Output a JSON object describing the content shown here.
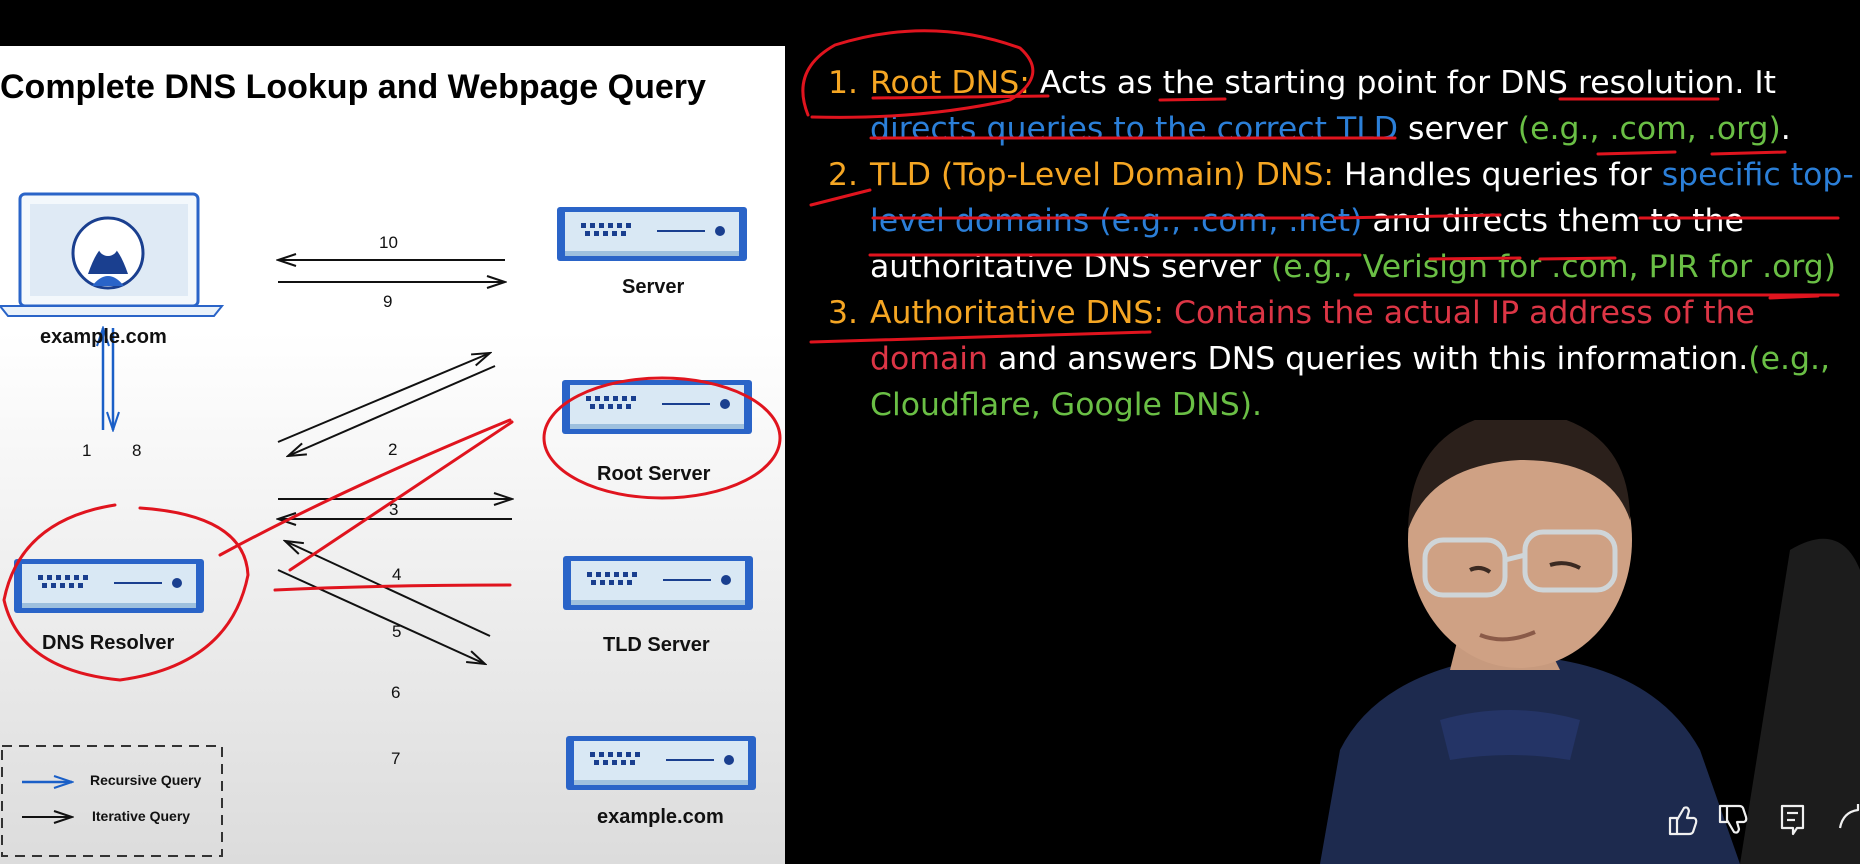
{
  "diagram": {
    "title": "Complete DNS Lookup and Webpage Query",
    "nodes": {
      "client": "example.com",
      "server": "Server",
      "root": "Root Server",
      "resolver": "DNS Resolver",
      "tld": "TLD Server",
      "auth": "example.com"
    },
    "steps": [
      "1",
      "2",
      "3",
      "4",
      "5",
      "6",
      "7",
      "8",
      "9",
      "10"
    ],
    "legend": {
      "recursive": "Recursive Query",
      "iterative": "Iterative Query"
    },
    "colors": {
      "recursive": "#1a5fc7",
      "iterative": "#111111",
      "annotation": "#e0141e"
    }
  },
  "notes": [
    {
      "number": "1.",
      "lines": [
        [
          {
            "t": "Root DNS: ",
            "c": "o"
          },
          {
            "t": "Acts as the starting point for DNS resolution. It",
            "c": "w"
          }
        ],
        [
          {
            "t": "directs queries to the correct TLD",
            "c": "b"
          },
          {
            "t": " server ",
            "c": "w"
          },
          {
            "t": "(e.g., .com, .org)",
            "c": "g"
          },
          {
            "t": ".",
            "c": "w"
          }
        ]
      ]
    },
    {
      "number": "2.",
      "lines": [
        [
          {
            "t": "TLD (Top-Level Domain) DNS: ",
            "c": "o"
          },
          {
            "t": "Handles queries for ",
            "c": "w"
          },
          {
            "t": "specific top-",
            "c": "b"
          }
        ],
        [
          {
            "t": "level domains (e.g., .com, .net)",
            "c": "b"
          },
          {
            "t": " and directs them to the",
            "c": "w"
          }
        ],
        [
          {
            "t": "authoritative DNS server ",
            "c": "w"
          },
          {
            "t": "(e.g., Verisign for .com, PIR for .org)",
            "c": "g"
          }
        ]
      ]
    },
    {
      "number": "3.",
      "lines": [
        [
          {
            "t": "Authoritative DNS: ",
            "c": "o"
          },
          {
            "t": "Contains the actual IP address of the",
            "c": "r"
          }
        ],
        [
          {
            "t": "domain",
            "c": "r"
          },
          {
            "t": " and answers DNS queries with this information.",
            "c": "w"
          },
          {
            "t": "(e.g.,",
            "c": "g"
          }
        ],
        [
          {
            "t": "Cloudflare, Google DNS).",
            "c": "g"
          }
        ]
      ]
    }
  ],
  "player_controls": [
    {
      "name": "like-icon"
    },
    {
      "name": "dislike-icon"
    },
    {
      "name": "comment-icon"
    },
    {
      "name": "share-icon"
    }
  ]
}
